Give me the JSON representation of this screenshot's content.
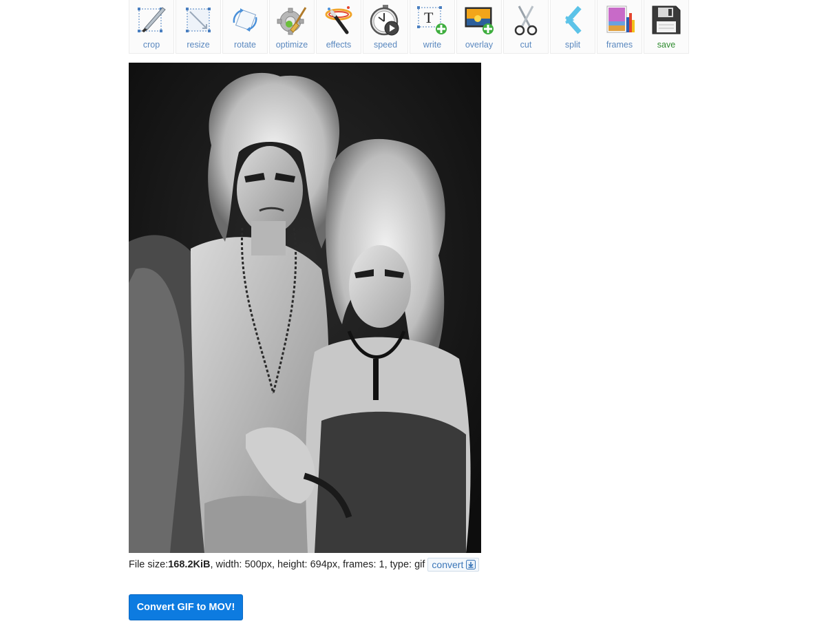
{
  "toolbar": {
    "tools": [
      {
        "label": "crop",
        "icon": "crop-icon"
      },
      {
        "label": "resize",
        "icon": "resize-icon"
      },
      {
        "label": "rotate",
        "icon": "rotate-icon"
      },
      {
        "label": "optimize",
        "icon": "optimize-icon"
      },
      {
        "label": "effects",
        "icon": "effects-icon"
      },
      {
        "label": "speed",
        "icon": "speed-icon"
      },
      {
        "label": "write",
        "icon": "write-icon"
      },
      {
        "label": "overlay",
        "icon": "overlay-icon"
      },
      {
        "label": "cut",
        "icon": "cut-icon"
      },
      {
        "label": "split",
        "icon": "split-icon"
      },
      {
        "label": "frames",
        "icon": "frames-icon"
      },
      {
        "label": "save",
        "icon": "save-icon"
      }
    ],
    "label_color": "#5a88bf",
    "save_color": "#2e8b2e"
  },
  "preview": {
    "alt": "black and white photo of two costumed people in powdered wigs"
  },
  "file_info": {
    "prefix": "File size: ",
    "size": "168.2KiB",
    "rest": ", width: 500px, height: 694px, frames: 1, type: gif",
    "convert_label": "convert"
  },
  "action": {
    "button_label": "Convert GIF to MOV!",
    "button_color": "#0d7be0"
  }
}
